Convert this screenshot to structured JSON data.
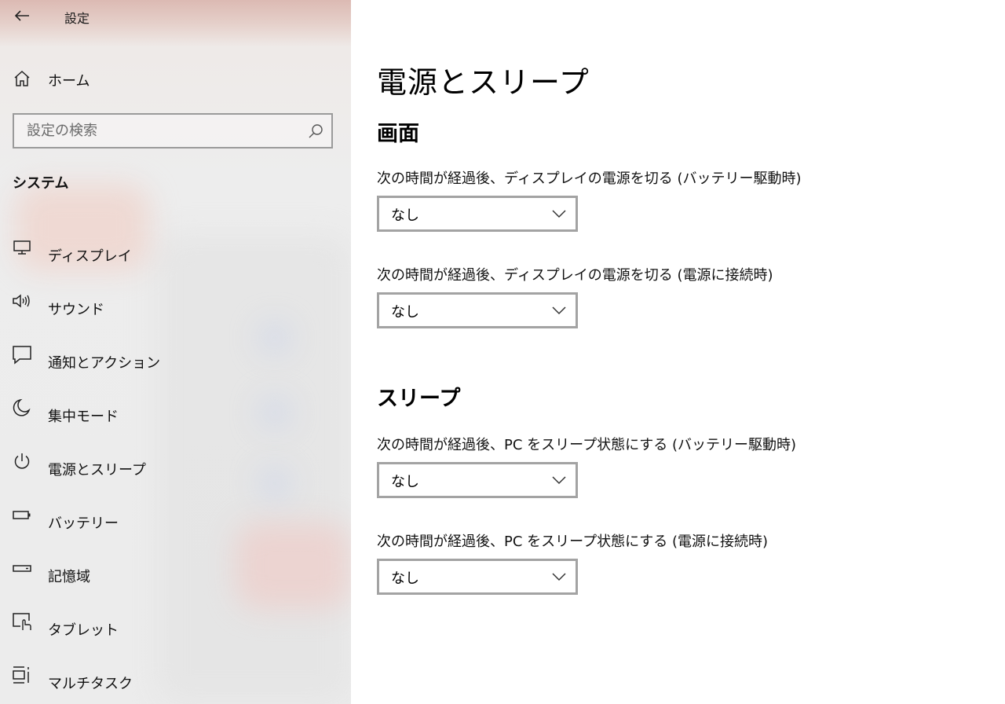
{
  "app": {
    "title": "設定"
  },
  "sidebar": {
    "home_label": "ホーム",
    "search": {
      "placeholder": "設定の検索"
    },
    "section_title": "システム",
    "items": [
      {
        "label": "ディスプレイ",
        "icon": "monitor-icon"
      },
      {
        "label": "サウンド",
        "icon": "speaker-icon"
      },
      {
        "label": "通知とアクション",
        "icon": "notification-icon"
      },
      {
        "label": "集中モード",
        "icon": "moon-icon"
      },
      {
        "label": "電源とスリープ",
        "icon": "power-icon"
      },
      {
        "label": "バッテリー",
        "icon": "battery-icon"
      },
      {
        "label": "記憶域",
        "icon": "storage-icon"
      },
      {
        "label": "タブレット",
        "icon": "tablet-icon"
      },
      {
        "label": "マルチタスク",
        "icon": "multitask-icon"
      }
    ]
  },
  "main": {
    "page_title": "電源とスリープ",
    "screen": {
      "title": "画面",
      "settings": [
        {
          "label": "次の時間が経過後、ディスプレイの電源を切る (バッテリー駆動時)",
          "value": "なし"
        },
        {
          "label": "次の時間が経過後、ディスプレイの電源を切る (電源に接続時)",
          "value": "なし"
        }
      ]
    },
    "sleep": {
      "title": "スリープ",
      "settings": [
        {
          "label": "次の時間が経過後、PC をスリープ状態にする (バッテリー駆動時)",
          "value": "なし"
        },
        {
          "label": "次の時間が経過後、PC をスリープ状態にする (電源に接続時)",
          "value": "なし"
        }
      ]
    }
  },
  "colors": {
    "dropdown_border": "#a3a3a3",
    "sidebar_bg": "#ececec",
    "titlebar_tint": "#dcbab3"
  }
}
